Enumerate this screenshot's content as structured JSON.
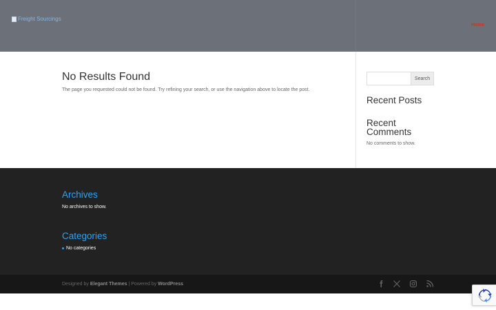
{
  "header": {
    "logo_alt": "Freight Sourcings",
    "nav": {
      "home_label": "Home"
    }
  },
  "main": {
    "title": "No Results Found",
    "message": "The page you requested could not be found. Try refining your search, or use the navigation above to locate the post."
  },
  "sidebar": {
    "search": {
      "placeholder": "",
      "button_label": "Search"
    },
    "recent_posts_title": "Recent Posts",
    "recent_comments_title": "Recent Comments",
    "no_comments_text": "No comments to show."
  },
  "footer": {
    "archives_title": "Archives",
    "no_archives_text": "No archives to show.",
    "categories_title": "Categories",
    "no_categories_text": "No categories"
  },
  "bottom_bar": {
    "designed_by_prefix": "Designed by ",
    "designer": "Elegant Themes",
    "powered_by_prefix": " | Powered by ",
    "platform": "WordPress",
    "social_icons": [
      "facebook-icon",
      "x-icon",
      "instagram-icon",
      "rss-icon"
    ]
  },
  "colors": {
    "header_bg": "#6c7079",
    "footer_bg": "#222222",
    "bottom_bar_bg": "#171717",
    "accent": "#2ea3f2",
    "nav_home": "#c0392b"
  }
}
